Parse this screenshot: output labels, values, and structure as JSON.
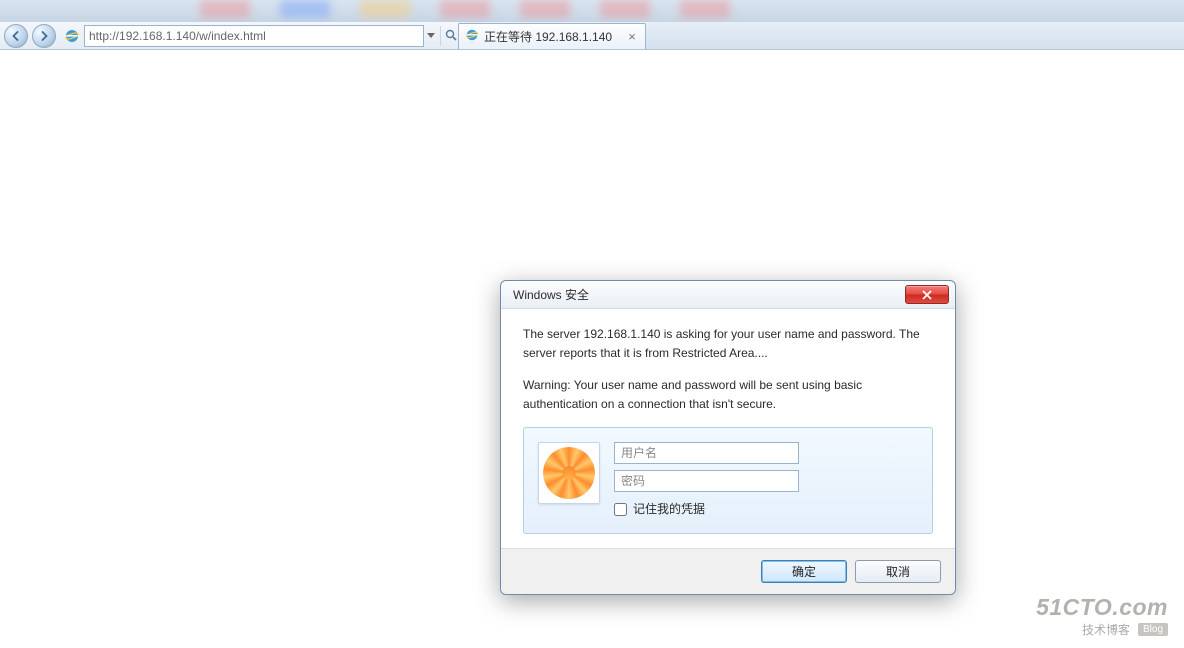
{
  "browser": {
    "url": "http://192.168.1.140/w/index.html",
    "tab_title": "正在等待 192.168.1.140"
  },
  "dialog": {
    "title": "Windows 安全",
    "message1": "The server 192.168.1.140 is asking for your user name and password. The server reports that it is from Restricted Area....",
    "message2": "Warning: Your user name and password will be sent using basic authentication on a connection that isn't secure.",
    "username_placeholder": "用户名",
    "password_placeholder": "密码",
    "remember_label": "记住我的凭据",
    "ok_label": "确定",
    "cancel_label": "取消"
  },
  "watermark": {
    "brand": "51CTO.com",
    "tagline": "技术博客",
    "badge": "Blog"
  }
}
